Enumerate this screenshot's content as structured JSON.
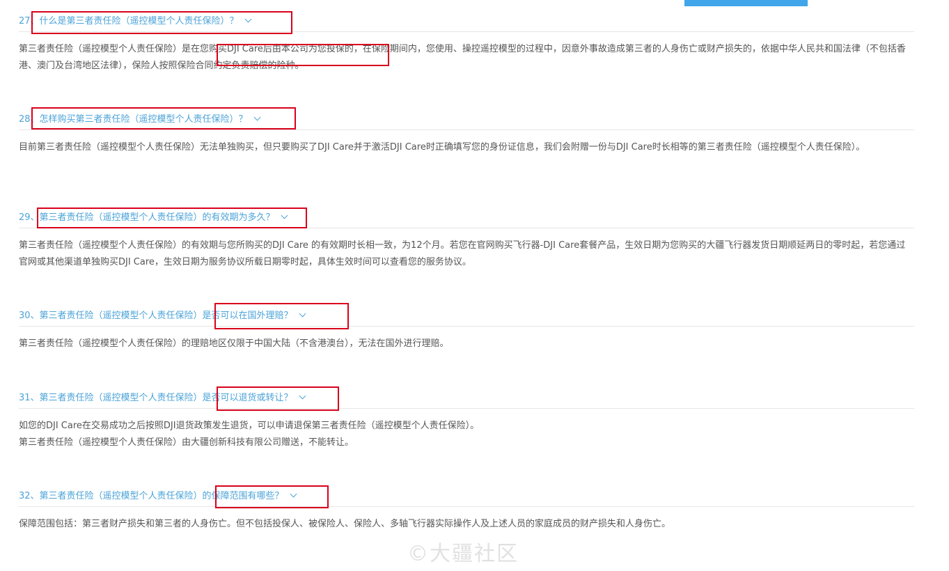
{
  "faqs": [
    {
      "question": "27、什么是第三者责任险（遥控模型个人责任保险）？",
      "answer": [
        "第三者责任险（遥控模型个人责任保险）是在您购买DJI Care后由本公司为您投保的，在保险期间内，您使用、操控遥控模型的过程中，因意外事故造成第三者的人身伤亡或财产损失的，依据中华人民共和国法律（不包括香港、澳门及台湾地区法律），保险人按照保险合同约定负责赔偿的险种。"
      ]
    },
    {
      "question": "28、怎样购买第三者责任险（遥控模型个人责任保险）？",
      "answer": [
        "目前第三者责任险（遥控模型个人责任保险）无法单独购买，但只要购买了DJI Care并于激活DJI Care时正确填写您的身份证信息，我们会附赠一份与DJI Care时长相等的第三者责任险（遥控模型个人责任保险）。"
      ]
    },
    {
      "question": "29、第三者责任险（遥控模型个人责任保险）的有效期为多久？",
      "answer": [
        "第三者责任险（遥控模型个人责任保险）的有效期与您所购买的DJI Care 的有效期时长相一致，为12个月。若您在官网购买飞行器-DJI Care套餐产品，生效日期为您购买的大疆飞行器发货日期顺延两日的零时起，若您通过官网或其他渠道单独购买DJI Care，生效日期为服务协议所载日期零时起，具体生效时间可以查看您的服务协议。"
      ]
    },
    {
      "question": "30、第三者责任险（遥控模型个人责任保险）是否可以在国外理赔？",
      "answer": [
        "第三者责任险（遥控模型个人责任保险）的理赔地区仅限于中国大陆（不含港澳台），无法在国外进行理赔。"
      ]
    },
    {
      "question": "31、第三者责任险（遥控模型个人责任保险）是否可以退货或转让？",
      "answer": [
        "如您的DJI Care在交易成功之后按照DJI退货政策发生退货，可以申请退保第三者责任险（遥控模型个人责任保险）。",
        "第三者责任险（遥控模型个人责任保险）由大疆创新科技有限公司赠送，不能转让。"
      ]
    },
    {
      "question": "32、第三者责任险（遥控模型个人责任保险）的保障范围有哪些？",
      "answer": [
        "保障范围包括：第三者财产损失和第三者的人身伤亡。但不包括投保人、被保险人、保险人、多轴飞行器实际操作人及上述人员的家庭成员的财产损失和人身伤亡。"
      ]
    }
  ],
  "watermark": "©大疆社区",
  "colors": {
    "question": "#4ba3d8",
    "answer": "#555555",
    "highlight_box": "#d9001b",
    "top_bar": "#41a5e9"
  }
}
